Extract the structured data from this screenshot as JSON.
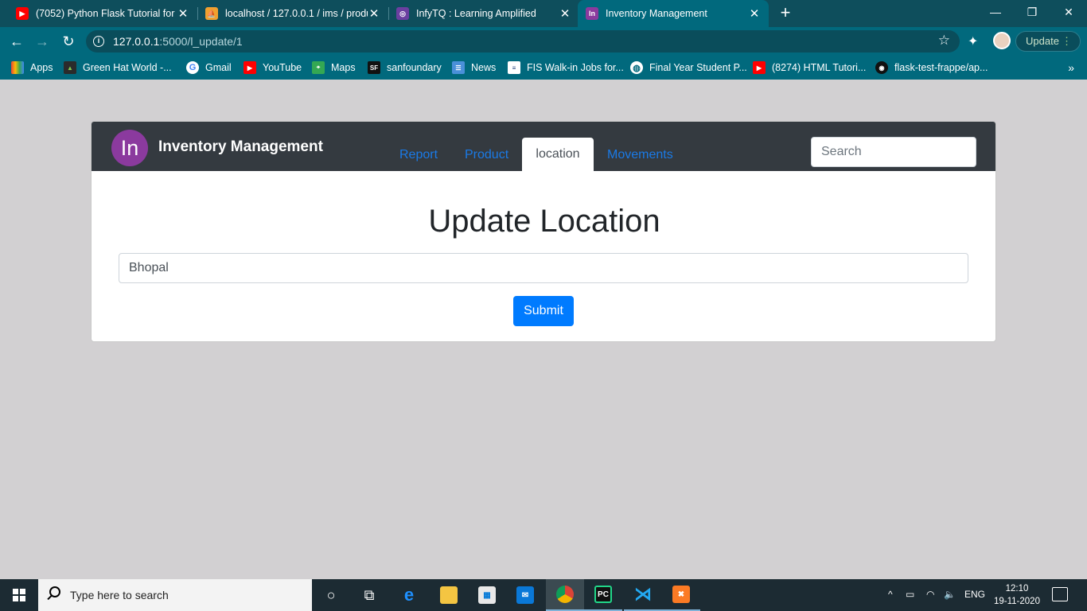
{
  "browser": {
    "tabs": [
      {
        "title": "(7052) Python Flask Tutorial for B",
        "icon": "youtube-icon",
        "active": false
      },
      {
        "title": "localhost / 127.0.0.1 / ims / produ",
        "icon": "phpmyadmin-icon",
        "active": false
      },
      {
        "title": "InfyTQ : Learning Amplified",
        "icon": "infytq-icon",
        "active": false
      },
      {
        "title": "Inventory Management",
        "icon": "inventory-favicon",
        "active": true
      }
    ],
    "window_controls": {
      "minimize": "—",
      "maximize": "❐",
      "close": "✕"
    },
    "url_host": "127.0.0.1",
    "url_rest": ":5000/l_update/1",
    "update_label": "Update",
    "bookmarks": [
      {
        "label": "Apps",
        "icon": "apps-grid-icon"
      },
      {
        "label": "Green Hat World -...",
        "icon": "greenhat-icon"
      },
      {
        "label": "Gmail",
        "icon": "google-icon"
      },
      {
        "label": "YouTube",
        "icon": "youtube-icon"
      },
      {
        "label": "Maps",
        "icon": "maps-icon"
      },
      {
        "label": "sanfoundary",
        "icon": "sanfoundry-icon"
      },
      {
        "label": "News",
        "icon": "news-icon"
      },
      {
        "label": "FIS Walk-in Jobs for...",
        "icon": "fis-icon"
      },
      {
        "label": "Final Year Student P...",
        "icon": "globe-icon"
      },
      {
        "label": "(8274) HTML Tutori...",
        "icon": "youtube-icon"
      },
      {
        "label": "flask-test-frappe/ap...",
        "icon": "github-icon"
      }
    ]
  },
  "app": {
    "logo_text": "In",
    "brand": "Inventory Management",
    "nav": {
      "report": "Report",
      "product": "Product",
      "location": "location",
      "movements": "Movements"
    },
    "search_placeholder": "Search",
    "page_title": "Update Location",
    "location_value": "Bhopal",
    "submit_label": "Submit"
  },
  "taskbar": {
    "search_placeholder": "Type here to search",
    "language": "ENG",
    "time": "12:10",
    "date": "19-11-2020"
  },
  "colors": {
    "tab_strip": "#0e4e5c",
    "toolbar": "#01697d",
    "navbar": "#343a40",
    "primary": "#007bff",
    "link": "#1a7ae6",
    "page_bg": "#d2d0d2"
  }
}
